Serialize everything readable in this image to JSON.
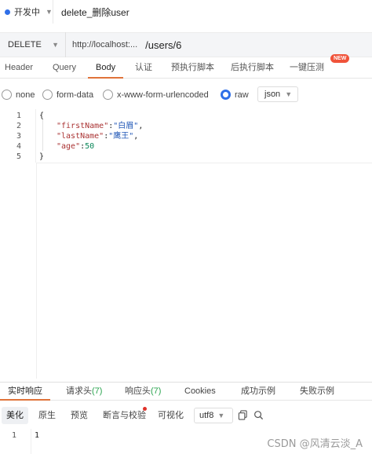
{
  "status": {
    "label": "开发中"
  },
  "request": {
    "name": "delete_删除user"
  },
  "url": {
    "method": "DELETE",
    "host": "http://localhost:...",
    "path": "/users/6"
  },
  "tabs": [
    {
      "label": "Header"
    },
    {
      "label": "Query"
    },
    {
      "label": "Body"
    },
    {
      "label": "认证"
    },
    {
      "label": "预执行脚本"
    },
    {
      "label": "后执行脚本"
    },
    {
      "label": "一键压测",
      "badge": "NEW"
    }
  ],
  "body_types": {
    "options": [
      "none",
      "form-data",
      "x-www-form-urlencoded",
      "raw"
    ],
    "selected": "raw",
    "format": "json"
  },
  "editor": {
    "line_numbers": [
      "1",
      "2",
      "3",
      "4",
      "5"
    ],
    "lines": {
      "open": "{",
      "firstName_key": "\"firstName\"",
      "firstName_val": "\"白眉\"",
      "lastName_key": "\"lastName\"",
      "lastName_val": "\"鹰王\"",
      "age_key": "\"age\"",
      "age_val": "50",
      "close": "}"
    }
  },
  "response_tabs": [
    {
      "label": "实时响应"
    },
    {
      "label": "请求头",
      "count": "(7)"
    },
    {
      "label": "响应头",
      "count": "(7)"
    },
    {
      "label": "Cookies"
    },
    {
      "label": "成功示例"
    },
    {
      "label": "失败示例"
    }
  ],
  "response_tools": {
    "views": [
      "美化",
      "原生",
      "预览",
      "断言与校验",
      "可视化"
    ],
    "encoding": "utf8"
  },
  "response": {
    "line_number": "1",
    "content": "1"
  },
  "watermark": "CSDN @风清云淡_A",
  "colors": {
    "accent": "#e0733a",
    "primary": "#2f6fe8",
    "badge": "#f0533a"
  }
}
